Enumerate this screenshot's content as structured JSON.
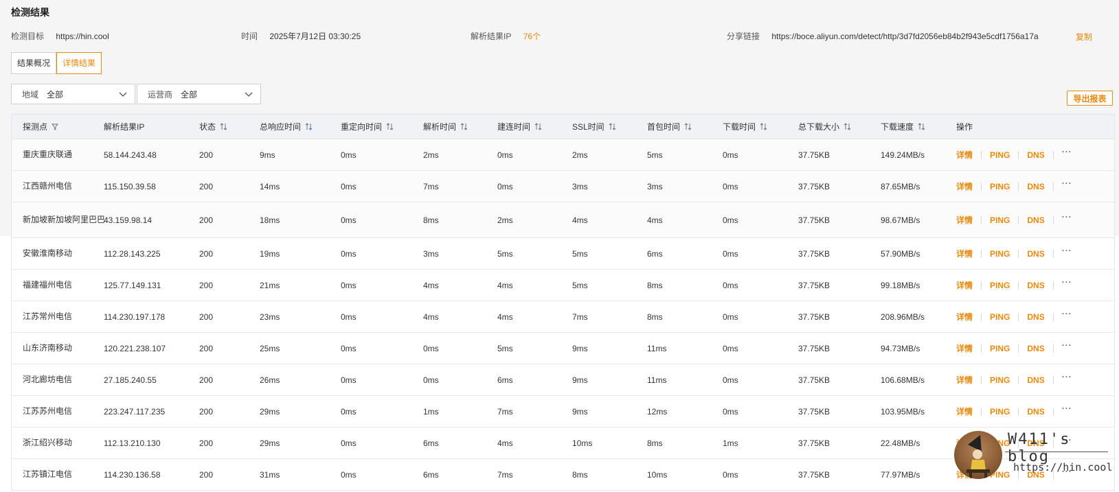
{
  "title": "检测结果",
  "info": {
    "target_label": "检测目标",
    "target_value": "https://hin.cool",
    "time_label": "时间",
    "time_value": "2025年7月12日 03:30:25",
    "ip_label": "解析结果IP",
    "ip_count": "76个",
    "share_label": "分享链接",
    "share_value": "https://boce.aliyun.com/detect/http/3d7fd2056eb84b2f943e5cdf1756a17a",
    "copy_label": "复制"
  },
  "tabs": [
    {
      "label": "结果概况",
      "active": false
    },
    {
      "label": "详情结果",
      "active": true
    }
  ],
  "filters": {
    "region": {
      "label": "地域",
      "value": "全部"
    },
    "isp": {
      "label": "运营商",
      "value": "全部"
    }
  },
  "export_label": "导出报表",
  "columns": [
    "探测点",
    "解析结果IP",
    "状态",
    "总响应时间",
    "重定向时间",
    "解析时间",
    "建连时间",
    "SSL时间",
    "首包时间",
    "下载时间",
    "总下载大小",
    "下载速度",
    "操作"
  ],
  "ops": {
    "detail": "详情",
    "ping": "PING",
    "dns": "DNS",
    "more": "···"
  },
  "rows": [
    {
      "probe": "重庆重庆联通",
      "ip": "58.144.243.48",
      "status": "200",
      "total": "9ms",
      "redirect": "0ms",
      "resolve": "2ms",
      "connect": "0ms",
      "ssl": "2ms",
      "first": "5ms",
      "download": "0ms",
      "size": "37.75KB",
      "speed": "149.24MB/s"
    },
    {
      "probe": "江西赣州电信",
      "ip": "115.150.39.58",
      "status": "200",
      "total": "14ms",
      "redirect": "0ms",
      "resolve": "7ms",
      "connect": "0ms",
      "ssl": "3ms",
      "first": "3ms",
      "download": "0ms",
      "size": "37.75KB",
      "speed": "87.65MB/s"
    },
    {
      "probe": "新加坡新加坡阿里巴巴",
      "ip": "43.159.98.14",
      "status": "200",
      "total": "18ms",
      "redirect": "0ms",
      "resolve": "8ms",
      "connect": "2ms",
      "ssl": "4ms",
      "first": "4ms",
      "download": "0ms",
      "size": "37.75KB",
      "speed": "98.67MB/s"
    },
    {
      "probe": "安徽淮南移动",
      "ip": "112.28.143.225",
      "status": "200",
      "total": "19ms",
      "redirect": "0ms",
      "resolve": "3ms",
      "connect": "5ms",
      "ssl": "5ms",
      "first": "6ms",
      "download": "0ms",
      "size": "37.75KB",
      "speed": "57.90MB/s"
    },
    {
      "probe": "福建福州电信",
      "ip": "125.77.149.131",
      "status": "200",
      "total": "21ms",
      "redirect": "0ms",
      "resolve": "4ms",
      "connect": "4ms",
      "ssl": "5ms",
      "first": "8ms",
      "download": "0ms",
      "size": "37.75KB",
      "speed": "99.18MB/s"
    },
    {
      "probe": "江苏常州电信",
      "ip": "114.230.197.178",
      "status": "200",
      "total": "23ms",
      "redirect": "0ms",
      "resolve": "4ms",
      "connect": "4ms",
      "ssl": "7ms",
      "first": "8ms",
      "download": "0ms",
      "size": "37.75KB",
      "speed": "208.96MB/s"
    },
    {
      "probe": "山东济南移动",
      "ip": "120.221.238.107",
      "status": "200",
      "total": "25ms",
      "redirect": "0ms",
      "resolve": "0ms",
      "connect": "5ms",
      "ssl": "9ms",
      "first": "11ms",
      "download": "0ms",
      "size": "37.75KB",
      "speed": "94.73MB/s"
    },
    {
      "probe": "河北廊坊电信",
      "ip": "27.185.240.55",
      "status": "200",
      "total": "26ms",
      "redirect": "0ms",
      "resolve": "0ms",
      "connect": "6ms",
      "ssl": "9ms",
      "first": "11ms",
      "download": "0ms",
      "size": "37.75KB",
      "speed": "106.68MB/s"
    },
    {
      "probe": "江苏苏州电信",
      "ip": "223.247.117.235",
      "status": "200",
      "total": "29ms",
      "redirect": "0ms",
      "resolve": "1ms",
      "connect": "7ms",
      "ssl": "9ms",
      "first": "12ms",
      "download": "0ms",
      "size": "37.75KB",
      "speed": "103.95MB/s"
    },
    {
      "probe": "浙江绍兴移动",
      "ip": "112.13.210.130",
      "status": "200",
      "total": "29ms",
      "redirect": "0ms",
      "resolve": "6ms",
      "connect": "4ms",
      "ssl": "10ms",
      "first": "8ms",
      "download": "1ms",
      "size": "37.75KB",
      "speed": "22.48MB/s"
    },
    {
      "probe": "江苏镇江电信",
      "ip": "114.230.136.58",
      "status": "200",
      "total": "31ms",
      "redirect": "0ms",
      "resolve": "6ms",
      "connect": "7ms",
      "ssl": "8ms",
      "first": "10ms",
      "download": "0ms",
      "size": "37.75KB",
      "speed": "77.97MB/s"
    }
  ],
  "watermark": {
    "title": "W411's blog",
    "url": "https://hin.cool"
  },
  "colors": {
    "accent": "#e8890c",
    "header_bg": "#f0f2f5",
    "page_bg": "#f5f5f5"
  }
}
